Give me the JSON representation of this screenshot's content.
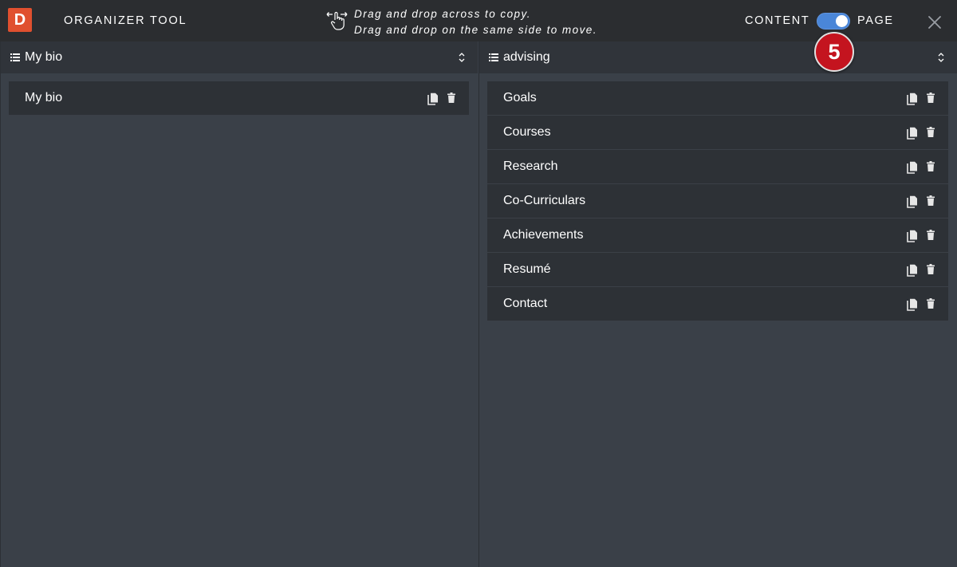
{
  "app": {
    "logo_letter": "D",
    "title": "ORGANIZER TOOL",
    "hint_line1": "Drag and drop across to copy.",
    "hint_line2": "Drag and drop on the same side to move.",
    "mode_left": "CONTENT",
    "mode_right": "PAGE",
    "mode_toggle_state": "page",
    "step_badge": "5"
  },
  "left_panel": {
    "selected": "My bio",
    "items": [
      {
        "label": "My bio"
      }
    ]
  },
  "right_panel": {
    "selected": "advising",
    "items": [
      {
        "label": "Goals"
      },
      {
        "label": "Courses"
      },
      {
        "label": "Research"
      },
      {
        "label": "Co-Curriculars"
      },
      {
        "label": "Achievements"
      },
      {
        "label": "Resumé"
      },
      {
        "label": "Contact"
      }
    ]
  },
  "colors": {
    "brand": "#e0502f",
    "toggle": "#4a86d8",
    "badge": "#c4141f",
    "topbar": "#2b2d30",
    "panel_bg": "#3a4048",
    "row_bg": "#2d3136"
  },
  "icons": [
    "list-icon",
    "sort-icon",
    "copy-icon",
    "trash-icon",
    "close-icon",
    "drag-hand-icon"
  ]
}
